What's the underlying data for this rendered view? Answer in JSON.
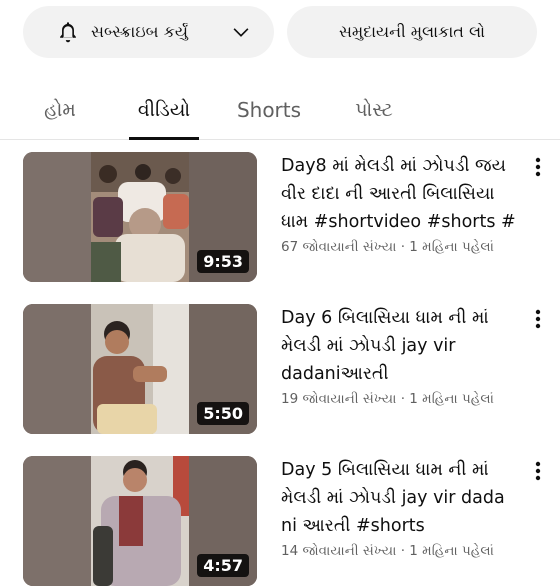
{
  "actions": {
    "subscribe_label": "સબ્સ્ક્રાઇબ કર્યું",
    "community_label": "સમુદાયની મુલાકાત લો"
  },
  "tabs": [
    {
      "label": "હોમ",
      "active": false
    },
    {
      "label": "વીડિયો",
      "active": true
    },
    {
      "label": "Shorts",
      "active": false
    },
    {
      "label": "પોસ્ટ",
      "active": false
    }
  ],
  "videos": [
    {
      "title": "Day8 માં મેલડી માં ઝોપડી જય વીર દાદા ની આરતી બિલાસિયા ધામ #shortvideo #shorts #",
      "duration": "9:53",
      "views": "67 જોવાયાની સંખ્યા",
      "age": "1 મહિના પહેલાં"
    },
    {
      "title": "Day 6 બિલાસિયા ધામ ની માં મેલડી માં ઝોપડી jay vir dadaniઆરતી",
      "duration": "5:50",
      "views": "19 જોવાયાની સંખ્યા",
      "age": "1 મહિના પહેલાં"
    },
    {
      "title": "Day 5 બિલાસિયા ધામ ની માં મેલડી માં ઝોપડી jay vir dada ni આરતી #shorts",
      "duration": "4:57",
      "views": "14 જોવાયાની સંખ્યા",
      "age": "1 મહિના પહેલાં"
    }
  ],
  "meta_separator": " · ",
  "colors": {
    "text_primary": "#0f0f0f",
    "text_secondary": "#606060",
    "pill_bg": "#f2f2f2",
    "divider": "#e5e5e5"
  },
  "icons": {
    "subscribe": "bell-icon",
    "dropdown": "chevron-down-icon",
    "overflow": "more-vertical-icon"
  }
}
